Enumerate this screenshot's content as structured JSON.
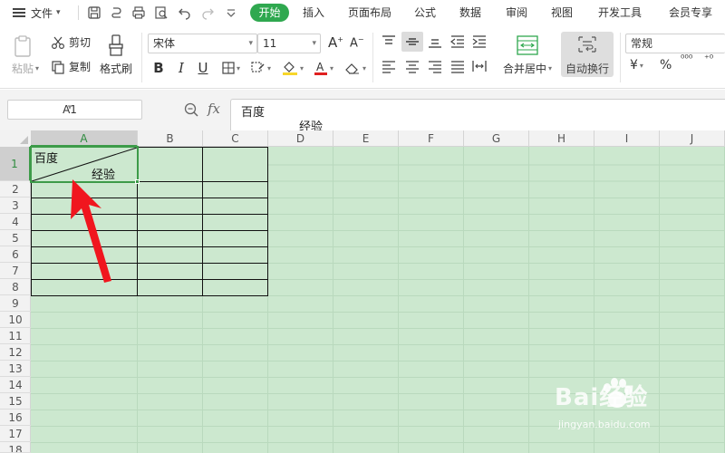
{
  "menu": {
    "file_label": "文件",
    "tabs": [
      "开始",
      "插入",
      "页面布局",
      "公式",
      "数据",
      "审阅",
      "视图",
      "开发工具",
      "会员专享"
    ],
    "active_tab": "开始"
  },
  "ribbon": {
    "paste_label": "粘贴",
    "cut_label": "剪切",
    "copy_label": "复制",
    "format_painter_label": "格式刷",
    "font_name": "宋体",
    "font_size": "11",
    "bold": "B",
    "italic": "I",
    "underline": "U",
    "merge_label": "合并居中",
    "wrap_label": "自动换行",
    "number_format": "常规",
    "currency": "¥",
    "percent": "%",
    "decimal_increase": "⁰⁰⁰",
    "thousand_sep": "⁺⁰"
  },
  "formula_bar": {
    "name_box": "A1",
    "fx": "fx",
    "content_line1": "百度",
    "content_line2": "经验"
  },
  "grid": {
    "columns": [
      "A",
      "B",
      "C",
      "D",
      "E",
      "F",
      "G",
      "H",
      "I",
      "J"
    ],
    "rows": [
      "1",
      "2",
      "3",
      "4",
      "5",
      "6",
      "7",
      "8",
      "9",
      "10",
      "11",
      "12",
      "13",
      "14",
      "15",
      "16",
      "17",
      "18"
    ],
    "selected_cell": "A1",
    "a1_top_text": "百度",
    "a1_bottom_text": "经验"
  },
  "annotation": {
    "arrow_color": "#f0161e"
  },
  "watermark": {
    "brand": "Bai经验",
    "url": "jingyan.baidu.com"
  },
  "colors": {
    "accent": "#2fa84f",
    "sheet_bg": "#cce8cf",
    "selection": "#3d9b49"
  }
}
